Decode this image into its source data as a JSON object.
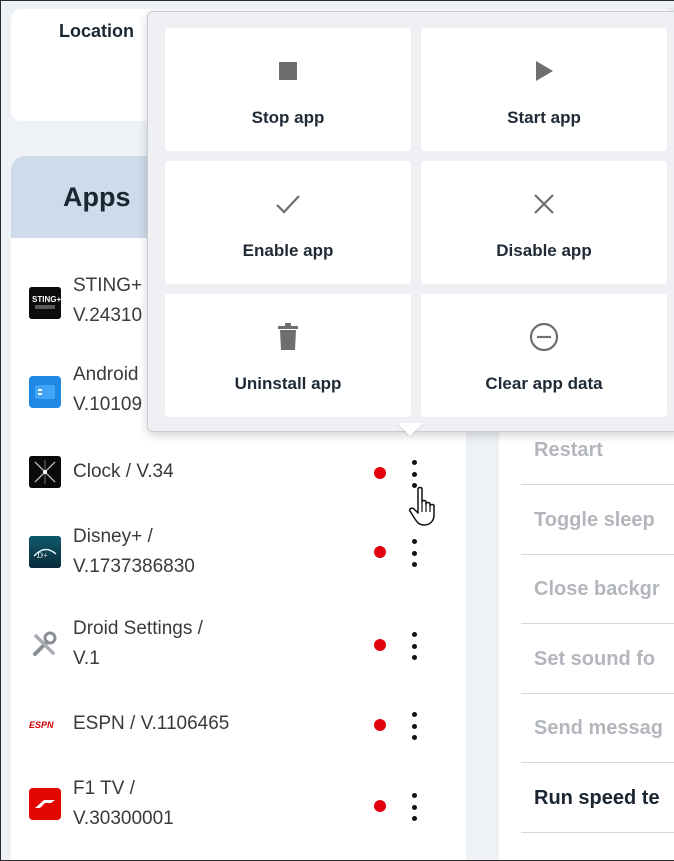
{
  "location": {
    "label": "Location"
  },
  "apps": {
    "title": "Apps",
    "items": [
      {
        "name": "STING+ /",
        "version": "V.24310",
        "icon": "sting-plus-icon",
        "dot": false,
        "kebab": false
      },
      {
        "name": "Android",
        "version": "V.10109",
        "icon": "android-tv-icon",
        "dot": false,
        "kebab": false
      },
      {
        "name": "Clock / V.34",
        "version": "",
        "icon": "clock-icon",
        "dot": true,
        "kebab": true
      },
      {
        "name": "Disney+ /",
        "version": "V.1737386830",
        "icon": "disney-plus-icon",
        "dot": true,
        "kebab": true
      },
      {
        "name": "Droid Settings /",
        "version": "V.1",
        "icon": "droid-settings-icon",
        "dot": true,
        "kebab": true
      },
      {
        "name": "ESPN / V.1106465",
        "version": "",
        "icon": "espn-icon",
        "dot": true,
        "kebab": true
      },
      {
        "name": "F1 TV /",
        "version": "V.30300001",
        "icon": "f1-tv-icon",
        "dot": true,
        "kebab": true
      }
    ]
  },
  "actions": {
    "items": [
      {
        "label": "Restart",
        "enabled": false
      },
      {
        "label": "Toggle sleep",
        "enabled": false
      },
      {
        "label": "Close backgr",
        "enabled": false
      },
      {
        "label": "Set sound fo",
        "enabled": false
      },
      {
        "label": "Send messag",
        "enabled": false
      },
      {
        "label": "Run speed te",
        "enabled": true
      }
    ]
  },
  "popup": {
    "stop": "Stop app",
    "start": "Start app",
    "enable": "Enable app",
    "disable": "Disable app",
    "uninstall": "Uninstall app",
    "clear": "Clear app data"
  },
  "colors": {
    "status_dot": "#e2000f",
    "header_bg": "#cfdbea",
    "icon_gray": "#6e6e6e"
  }
}
